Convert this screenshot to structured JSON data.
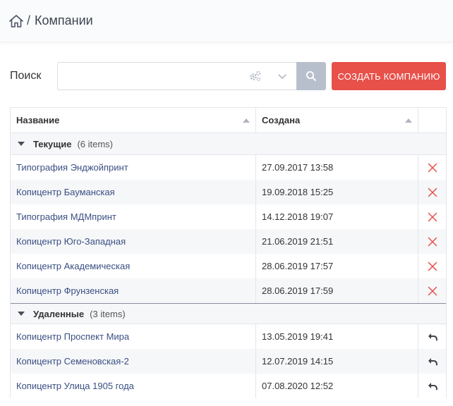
{
  "header": {
    "separator": "/",
    "title": "Компании"
  },
  "search": {
    "label": "Поиск",
    "value": "",
    "placeholder": ""
  },
  "toolbar": {
    "create_label": "СОЗДАТЬ КОМПАНИЮ"
  },
  "columns": {
    "name": "Название",
    "created": "Создана"
  },
  "groups": [
    {
      "title": "Текущие",
      "count": "(6 items)",
      "rows": [
        {
          "name": "Типография Энджойпринт",
          "created": "27.09.2017 13:58"
        },
        {
          "name": "Копицентр Бауманская",
          "created": "19.09.2018 15:25"
        },
        {
          "name": "Типография МДМпринт",
          "created": "14.12.2018 19:07"
        },
        {
          "name": "Копицентр Юго-Западная",
          "created": "21.06.2019 21:51"
        },
        {
          "name": "Копицентр Академическая",
          "created": "28.06.2019 17:57"
        },
        {
          "name": "Копицентр Фрунзенская",
          "created": "28.06.2019 17:59"
        }
      ]
    },
    {
      "title": "Удаленные",
      "count": "(3 items)",
      "rows": [
        {
          "name": "Копицентр Проспект Мира",
          "created": "13.05.2019 19:41"
        },
        {
          "name": "Копицентр Семеновская-2",
          "created": "12.07.2019 14:15"
        },
        {
          "name": "Копицентр Улица 1905 года",
          "created": "07.08.2020 12:52"
        }
      ]
    }
  ],
  "colors": {
    "accent_red": "#e8504a",
    "link": "#3a4f82",
    "search_button": "#b8bfcc"
  },
  "icons": {
    "home": "home-icon",
    "gears": "gears-icon",
    "chevron": "chevron-down-icon",
    "search": "search-icon",
    "sort": "sort-up-icon",
    "group_caret": "caret-down-icon",
    "delete": "close-icon",
    "restore": "undo-icon"
  }
}
